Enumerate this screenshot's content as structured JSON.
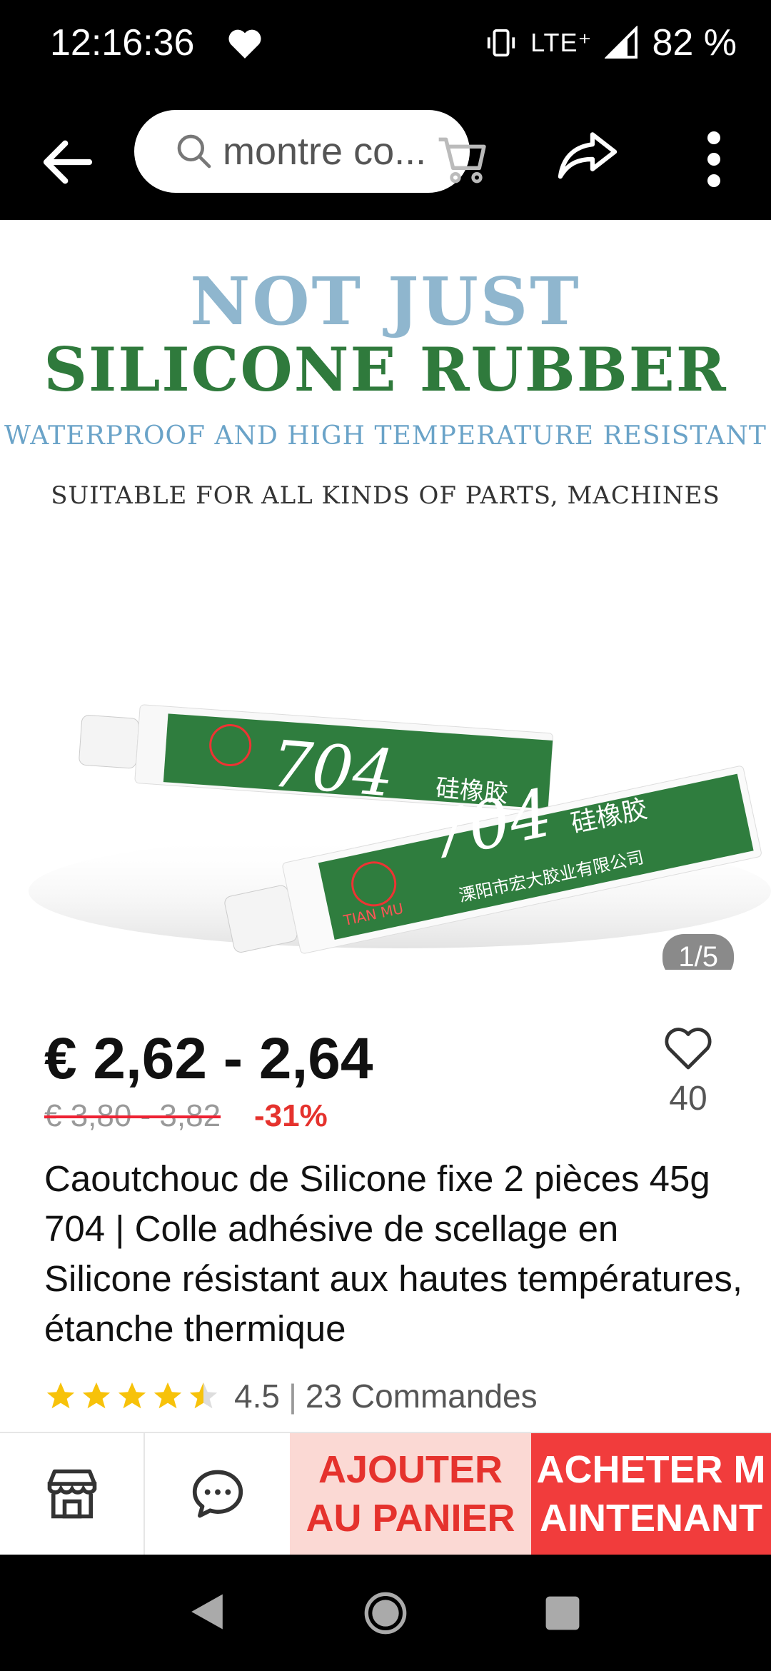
{
  "status_bar": {
    "time": "12:16:36",
    "network": "LTE⁺",
    "battery": "82 %"
  },
  "app_bar": {
    "search_text": "montre co...",
    "icons": [
      "back-arrow-icon",
      "search-icon",
      "cart-icon",
      "share-icon",
      "more-vert-icon"
    ]
  },
  "hero": {
    "line1": "NOT JUST",
    "line2": "SILICONE RUBBER",
    "line3": "WATERPROOF AND HIGH TEMPERATURE RESISTANT",
    "line4": "SUITABLE FOR ALL KINDS OF PARTS, MACHINES",
    "tube_number": "704",
    "tube_chinese": "硅橡胶",
    "tube_company": "溧阳市宏大胶业有限公司",
    "tube_brand": "TIAN MU",
    "page_indicator": "1/5"
  },
  "product": {
    "price": "€ 2,62 - 2,64",
    "old_price": "€ 3,80 - 3,82",
    "discount": "-31%",
    "wishlist_count": "40",
    "title": "Caoutchouc de Silicone fixe 2 pièces 45g 704 | Colle adhésive de scellage en Silicone résistant aux hautes températures, étanche thermique",
    "rating": "4.5",
    "rating_value": 4.5,
    "separator": "|",
    "orders": "23 Commandes"
  },
  "actions": {
    "add_to_cart": "AJOUTER\nAU PANIER",
    "buy_now": "ACHETER M\nAINTENANT"
  },
  "colors": {
    "accent_red": "#f13c3c",
    "cart_bg": "#fbd9d4",
    "star": "#f7c20a",
    "hero_green": "#2f7a3c",
    "hero_blue": "#8fb6ce"
  }
}
